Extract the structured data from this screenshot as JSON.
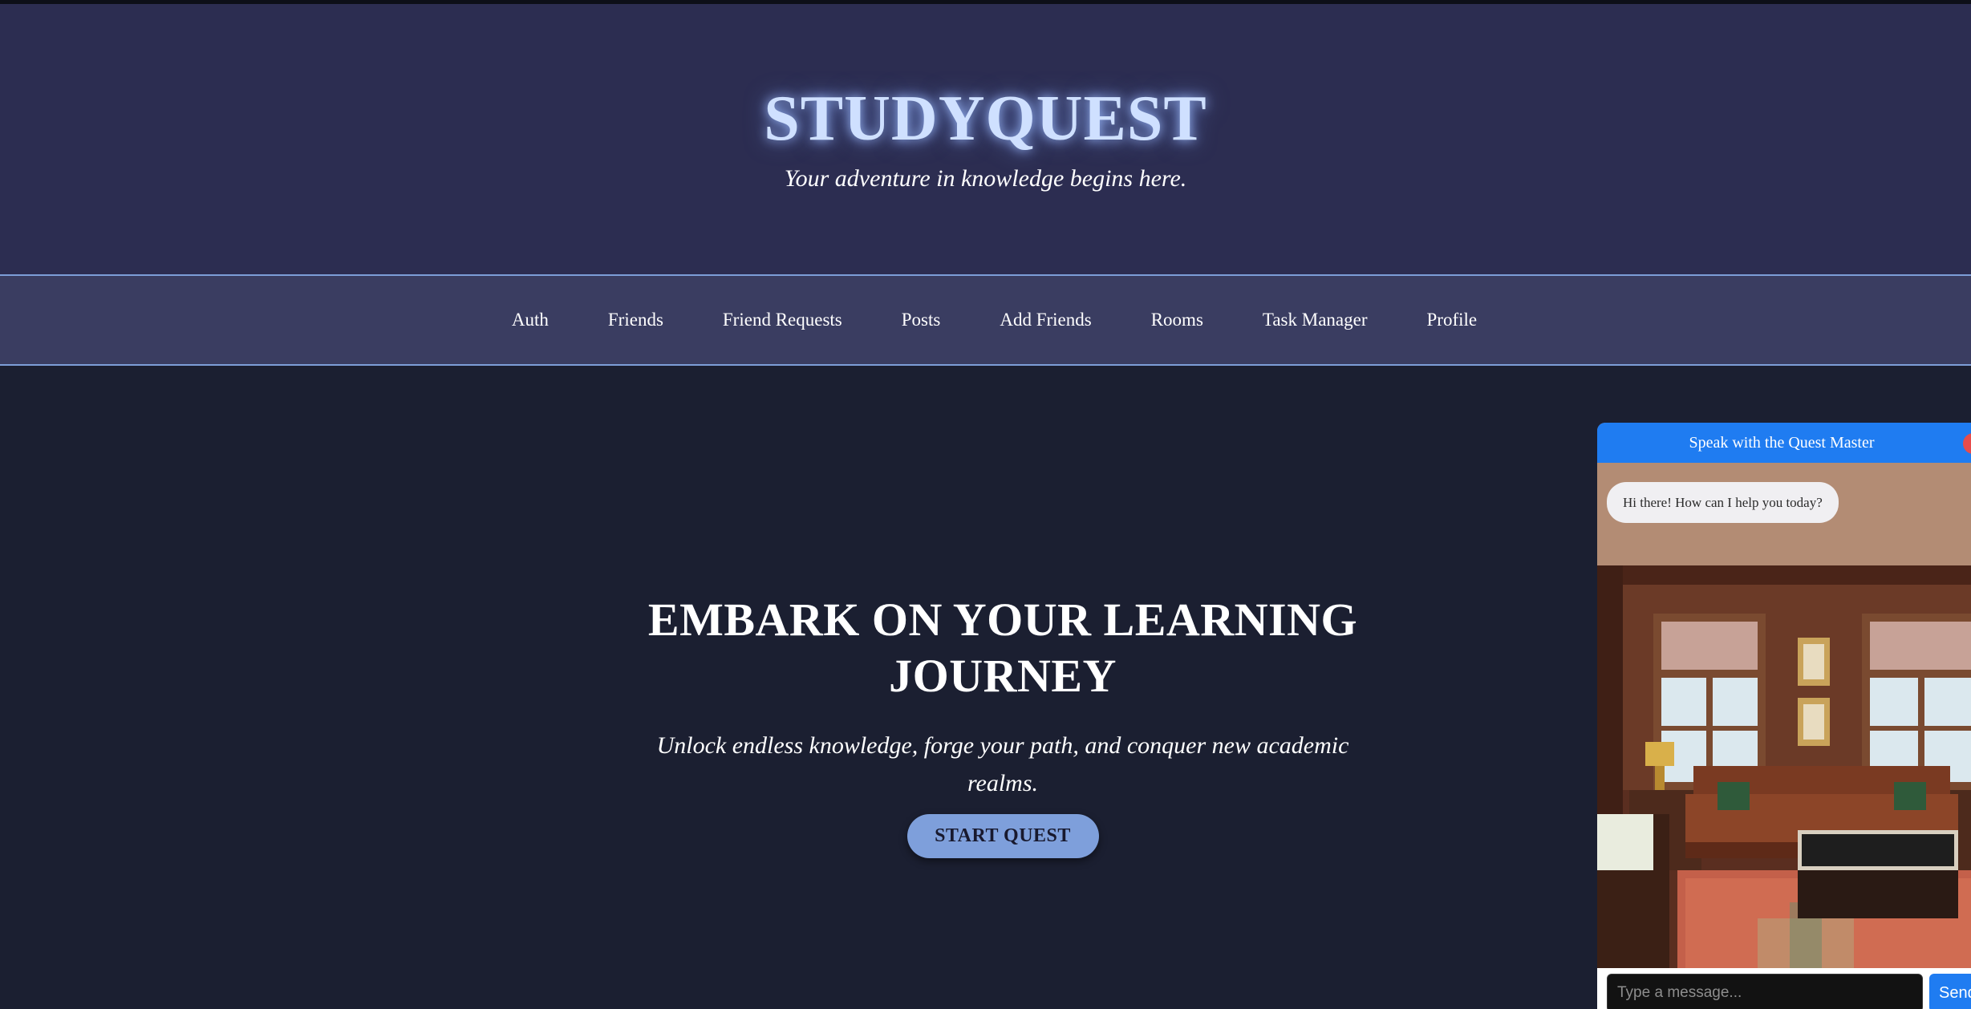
{
  "header": {
    "title": "STUDYQUEST",
    "tagline": "Your adventure in knowledge begins here."
  },
  "nav": {
    "items": [
      {
        "label": "Auth"
      },
      {
        "label": "Friends"
      },
      {
        "label": "Friend Requests"
      },
      {
        "label": "Posts"
      },
      {
        "label": "Add Friends"
      },
      {
        "label": "Rooms"
      },
      {
        "label": "Task Manager"
      },
      {
        "label": "Profile"
      }
    ]
  },
  "hero": {
    "title": "EMBARK ON YOUR LEARNING JOURNEY",
    "subtitle": "Unlock endless knowledge, forge your path, and conquer new academic realms.",
    "cta_label": "START QUEST"
  },
  "chat": {
    "header_title": "Speak with the Quest Master",
    "close_icon": "close-icon",
    "greeting": "Hi there! How can I help you today?",
    "input_placeholder": "Type a message...",
    "send_label": "Send"
  },
  "colors": {
    "header_bg": "#2c2d51",
    "nav_bg": "#3a3d61",
    "page_bg": "#1b1f31",
    "accent": "#7e9fdb",
    "chat_header": "#1f7cf1",
    "close_button": "#e74c4c"
  }
}
